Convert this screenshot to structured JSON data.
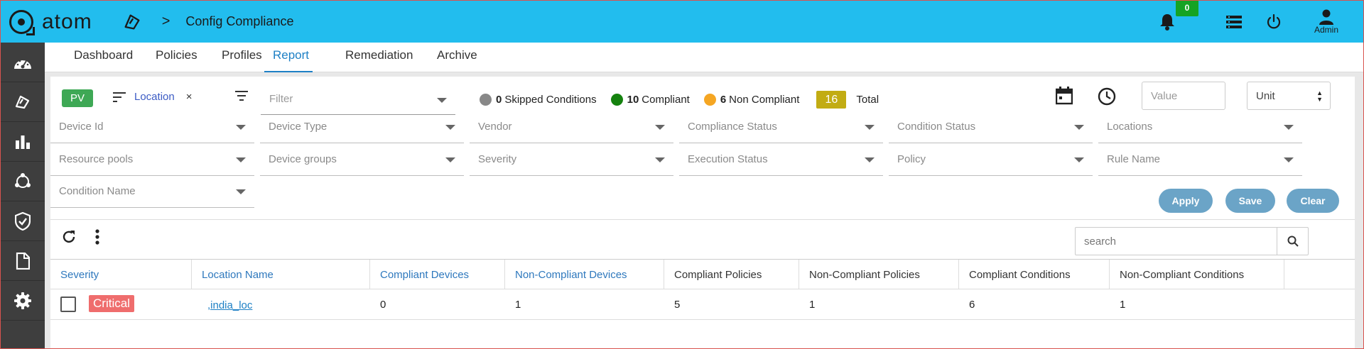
{
  "header": {
    "logo_text": "atom",
    "page_title": "Config Compliance",
    "breadcrumb_separator": ">",
    "notification_count": "0",
    "user_label": "Admin"
  },
  "tabs": [
    {
      "label": "Dashboard"
    },
    {
      "label": "Policies"
    },
    {
      "label": "Profiles"
    },
    {
      "label": "Report",
      "active": true
    },
    {
      "label": "Remediation"
    },
    {
      "label": "Archive"
    }
  ],
  "toolbar": {
    "pv_label": "PV",
    "group_chip_label": "Location",
    "chip_close": "×",
    "filter_placeholder": "Filter",
    "stats": {
      "skipped_count": "0",
      "skipped_label": "Skipped Conditions",
      "compliant_count": "10",
      "compliant_label": "Compliant",
      "noncompliant_count": "6",
      "noncompliant_label": "Non Compliant",
      "total_count": "16",
      "total_label": "Total"
    },
    "value_placeholder": "Value",
    "unit_label": "Unit"
  },
  "filters": {
    "row1": [
      "Device Id",
      "Device Type",
      "Vendor",
      "Compliance Status",
      "Condition Status",
      "Locations"
    ],
    "row2": [
      "Resource pools",
      "Device groups",
      "Severity",
      "Execution Status",
      "Policy",
      "Rule Name"
    ],
    "row3": [
      "Condition Name"
    ]
  },
  "actions": {
    "apply": "Apply",
    "save": "Save",
    "clear": "Clear"
  },
  "search": {
    "placeholder": "search"
  },
  "table": {
    "columns": [
      "Severity",
      "Location Name",
      "Compliant Devices",
      "Non-Compliant Devices",
      "Compliant Policies",
      "Non-Compliant Policies",
      "Compliant Conditions",
      "Non-Compliant Conditions"
    ],
    "rows": [
      {
        "severity": "Critical",
        "location": ",india_loc",
        "compliant_devices": "0",
        "noncompliant_devices": "1",
        "compliant_policies": "5",
        "noncompliant_policies": "1",
        "compliant_conditions": "6",
        "noncompliant_conditions": "1"
      }
    ]
  },
  "colors": {
    "header_bg": "#22bdee",
    "sidebar_bg": "#3e3e3e",
    "skipped": "#888888",
    "compliant": "#15820f",
    "noncompliant": "#f5a623",
    "critical": "#ef6d6d",
    "pv": "#3ea855",
    "total": "#c2ac13"
  }
}
